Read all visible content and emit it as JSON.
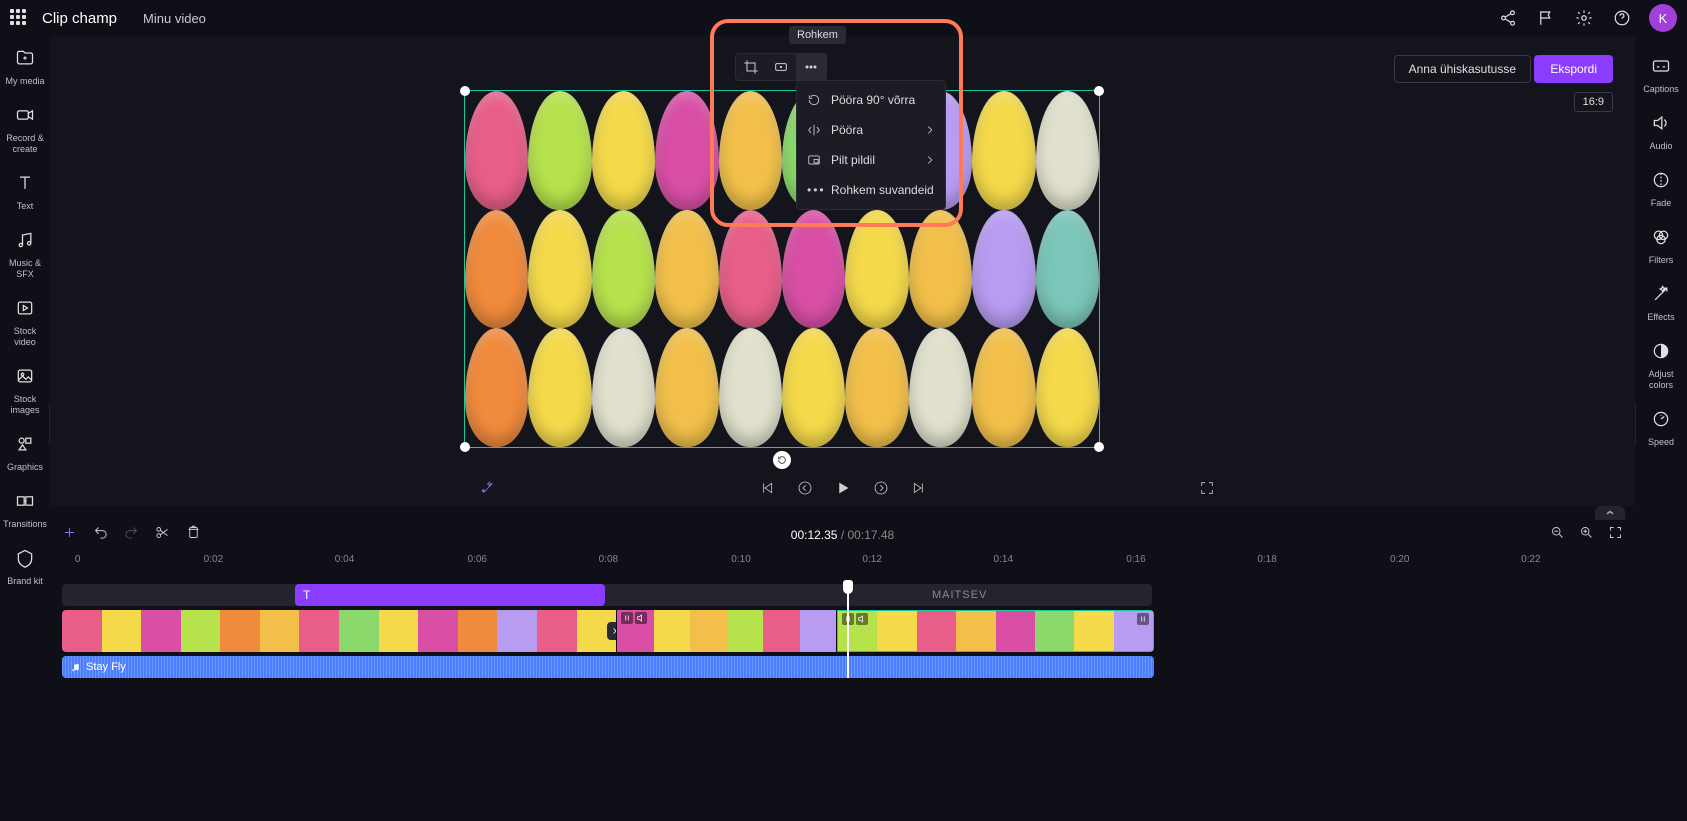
{
  "topbar": {
    "app_name": "Clip champ",
    "project_name": "Minu video",
    "share_label": "Anna ühiskasutusse",
    "export_label": "Ekspordi",
    "avatar_initial": "K"
  },
  "aspect_ratio": "16:9",
  "left_sidebar": [
    {
      "id": "my-media",
      "label": "My media"
    },
    {
      "id": "record-create",
      "label": "Record & create"
    },
    {
      "id": "text",
      "label": "Text"
    },
    {
      "id": "music-sfx",
      "label": "Music & SFX"
    },
    {
      "id": "stock-video",
      "label": "Stock video"
    },
    {
      "id": "stock-images",
      "label": "Stock images"
    },
    {
      "id": "graphics",
      "label": "Graphics"
    },
    {
      "id": "transitions",
      "label": "Transitions"
    },
    {
      "id": "brand-kit",
      "label": "Brand kit"
    }
  ],
  "right_sidebar": [
    {
      "id": "captions",
      "label": "Captions"
    },
    {
      "id": "audio",
      "label": "Audio"
    },
    {
      "id": "fade",
      "label": "Fade"
    },
    {
      "id": "filters",
      "label": "Filters"
    },
    {
      "id": "effects",
      "label": "Effects"
    },
    {
      "id": "adjust-colors",
      "label": "Adjust colors"
    },
    {
      "id": "speed",
      "label": "Speed"
    }
  ],
  "floating_toolbar": {
    "tooltip": "Rohkem"
  },
  "dropdown": {
    "rotate90": "Pööra 90° võrra",
    "flip": "Pööra",
    "pip": "Pilt pildil",
    "more": "Rohkem suvandeid"
  },
  "playback": {
    "current_time": "00:12.35",
    "separator": " / ",
    "duration": "00:17.48"
  },
  "ruler_ticks": [
    "0",
    "0:02",
    "0:04",
    "0:06",
    "0:08",
    "0:10",
    "0:12",
    "0:14",
    "0:16",
    "0:18",
    "0:20",
    "0:22"
  ],
  "tracks": {
    "text_clip_icon": "T",
    "text_overlay_label": "MAITSEV",
    "audio_title": "Stay Fly"
  }
}
